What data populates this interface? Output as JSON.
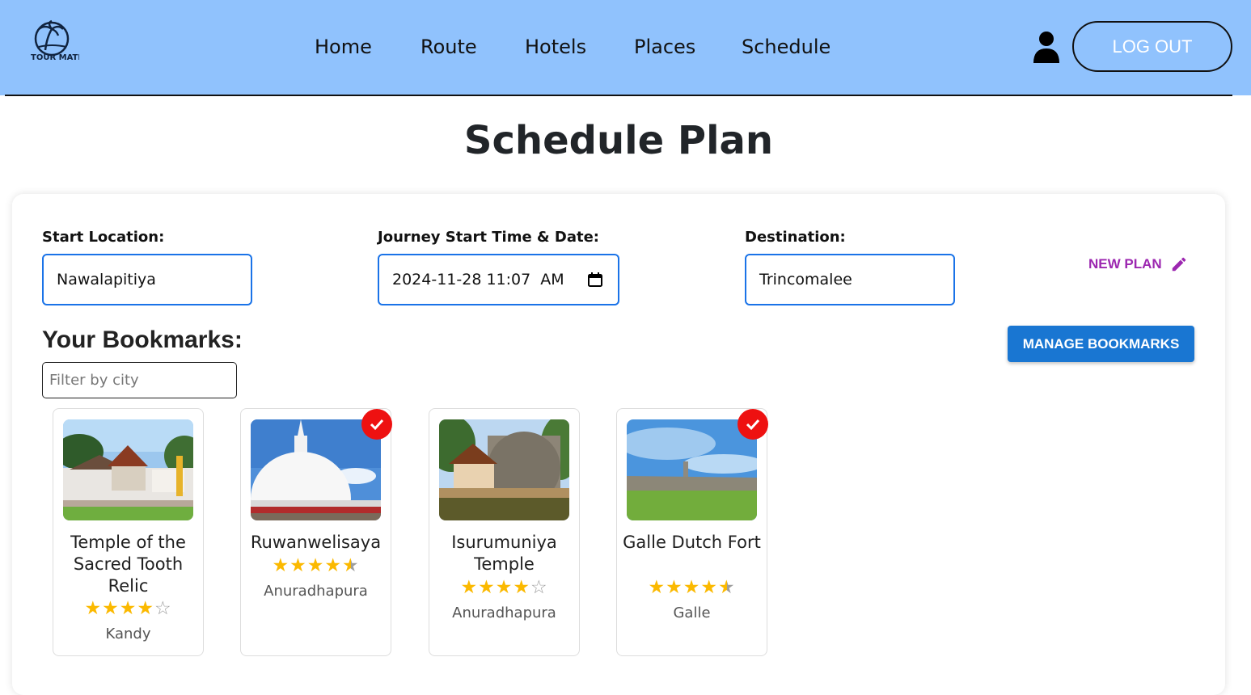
{
  "header": {
    "logo_text": "TOUR MATE",
    "nav": [
      "Home",
      "Route",
      "Hotels",
      "Places",
      "Schedule"
    ],
    "logout_label": "LOG OUT"
  },
  "page_title": "Schedule Plan",
  "form": {
    "start_location_label": "Start Location:",
    "start_location_value": "Nawalapitiya",
    "journey_label": "Journey Start Time & Date:",
    "journey_value": "2024-11-28 11:07  AM",
    "destination_label": "Destination:",
    "destination_value": "Trincomalee",
    "new_plan_label": "NEW PLAN"
  },
  "bookmarks": {
    "heading": "Your Bookmarks:",
    "manage_label": "MANAGE BOOKMARKS",
    "filter_placeholder": "Filter by city",
    "items": [
      {
        "name": "Temple of the Sacred Tooth Relic",
        "rating": 4,
        "city": "Kandy",
        "selected": false
      },
      {
        "name": "Ruwanwelisaya",
        "rating": 4.5,
        "city": "Anuradhapura",
        "selected": true
      },
      {
        "name": "Isurumuniya Temple",
        "rating": 4,
        "city": "Anuradhapura",
        "selected": false
      },
      {
        "name": "Galle Dutch Fort",
        "rating": 4.5,
        "city": "Galle",
        "selected": true
      }
    ]
  },
  "colors": {
    "header_bg": "#90c2fd",
    "input_border": "#1a73e8",
    "new_plan": "#9c27b0",
    "manage_button": "#1976d2",
    "star": "#fbb900",
    "check_badge": "#ee1111"
  },
  "icons": [
    "user-icon",
    "calendar-icon",
    "pencil-icon",
    "check-icon",
    "star-icon"
  ]
}
